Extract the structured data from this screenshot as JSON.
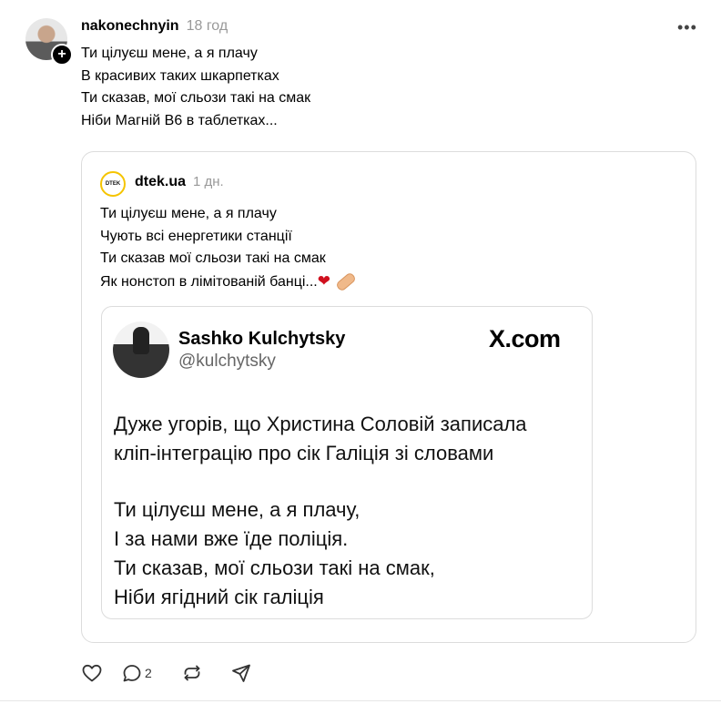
{
  "post": {
    "username": "nakonechnyin",
    "time": "18 год",
    "lines": [
      "Ти цілуєш мене, а я плачу",
      "В красивих таких шкарпетках",
      "Ти сказав, мої сльози такі на смак",
      "Ніби Магній В6 в таблетках..."
    ],
    "more_icon": "more-horizontal-icon"
  },
  "quote": {
    "logo_text": "DTEK",
    "username": "dtek.ua",
    "time": "1 дн.",
    "lines": [
      "Ти цілуєш мене, а я плачу",
      "Чують всі енергетики станції",
      "Ти сказав мої сльози такі на смак",
      "Як нонстоп в лімітованій банці..."
    ],
    "emoji": [
      "heart",
      "bandage"
    ],
    "embed": {
      "name": "Sashko Kulchytsky",
      "handle": "@kulchytsky",
      "source": "X.com",
      "paragraph1": [
        "Дуже угорів, що Христина Соловій записала",
        "кліп-інтеграцію про сік Галіція зі словами"
      ],
      "paragraph2": [
        "Ти цілуєш мене, а я плачу,",
        "І за нами вже їде поліція.",
        "Ти сказав, мої сльози такі на смак,",
        "Ніби ягідний сік галіція"
      ]
    }
  },
  "actions": {
    "like_icon": "heart-icon",
    "reply_icon": "comment-icon",
    "reply_count": "2",
    "repost_icon": "repost-icon",
    "share_icon": "send-icon"
  },
  "colors": {
    "heart": "#d0101e",
    "logo_ring": "#f5c400",
    "muted": "#999999"
  }
}
